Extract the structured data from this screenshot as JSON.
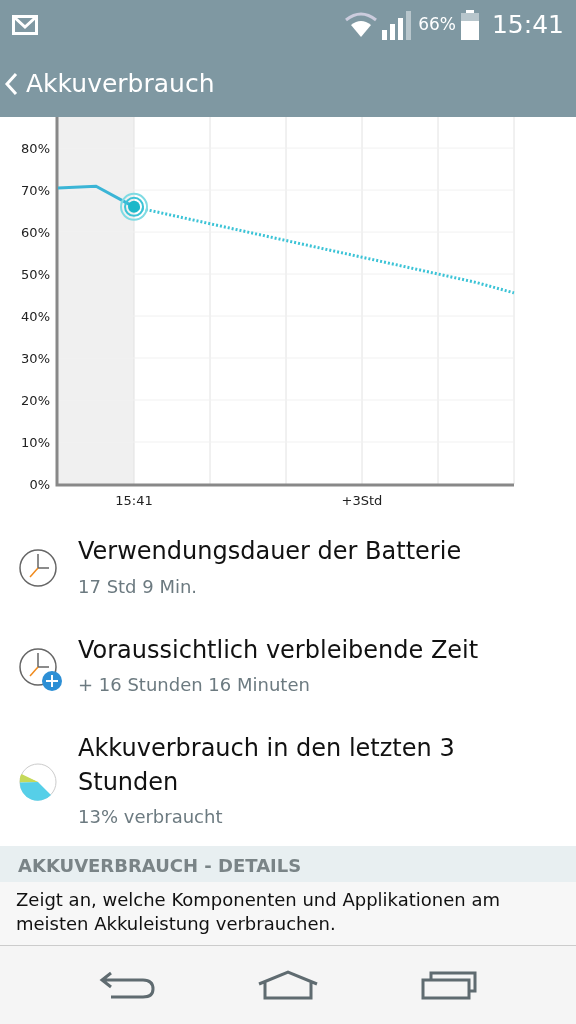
{
  "status_bar": {
    "battery_text": "66%",
    "time": "15:41"
  },
  "app_bar": {
    "title": "Akkuverbrauch"
  },
  "chart": {
    "chart_data": {
      "type": "line",
      "grid": true,
      "categories": [
        null,
        null,
        "15:41",
        null,
        null,
        null,
        null,
        null,
        "+3Std",
        null,
        null,
        null,
        null
      ],
      "series": [
        {
          "color": "#3bb5d6",
          "line_style": "solid",
          "values": [
            70.5,
            70.9,
            66,
            null,
            null,
            null,
            null,
            null,
            null,
            null,
            null,
            null,
            null
          ]
        },
        {
          "color": "#3bc3d6",
          "line_style": "dotted",
          "values": [
            null,
            null,
            66,
            64,
            62,
            60,
            58,
            56,
            54,
            52,
            50,
            48,
            45.5
          ]
        }
      ],
      "ylim": [
        0,
        87.4
      ],
      "yticks": [
        {
          "value": 0,
          "label": "0%"
        },
        {
          "value": 10,
          "label": "10%"
        },
        {
          "value": 20,
          "label": "20%"
        },
        {
          "value": 30,
          "label": "30%"
        },
        {
          "value": 40,
          "label": "40%"
        },
        {
          "value": 50,
          "label": "50%"
        },
        {
          "value": 60,
          "label": "60%"
        },
        {
          "value": 70,
          "label": "70%"
        },
        {
          "value": 80,
          "label": "80%"
        }
      ]
    }
  },
  "items": [
    {
      "kind": "clock",
      "title": "Verwendungsdauer der Batterie",
      "subtitle": "17 Std 9 Min."
    },
    {
      "kind": "clock-plus",
      "title": "Voraussichtlich verbleibende Zeit",
      "subtitle": "+ 16 Stunden 16 Minuten"
    },
    {
      "kind": "pie",
      "title": "Akkuverbrauch in den letzten 3 Stunden",
      "subtitle": "13% verbraucht"
    }
  ],
  "section": {
    "header": "AKKUVERBRAUCH - DETAILS",
    "description": "Zeigt an, welche Komponenten und Applikationen am meisten Akkuleistung verbrauchen."
  }
}
